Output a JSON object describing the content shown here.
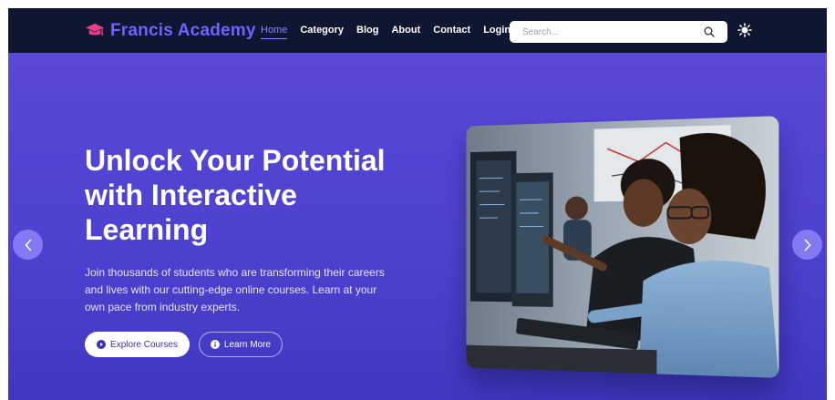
{
  "brand": {
    "name": "Francis Academy",
    "icon": "graduation-cap-icon",
    "color": "#6d63ff"
  },
  "nav": {
    "items": [
      {
        "label": "Home",
        "active": true
      },
      {
        "label": "Category",
        "active": false
      },
      {
        "label": "Blog",
        "active": false
      },
      {
        "label": "About",
        "active": false
      },
      {
        "label": "Contact",
        "active": false
      },
      {
        "label": "Login",
        "active": false
      }
    ]
  },
  "search": {
    "placeholder": "Search...",
    "value": "",
    "icon": "search-icon"
  },
  "theme_toggle": {
    "icon": "sun-icon"
  },
  "hero": {
    "title": "Unlock Your Potential with Interactive Learning",
    "description": "Join thousands of students who are transforming their careers and lives with our cutting-edge online courses. Learn at your own pace from industry experts.",
    "primary_button": {
      "label": "Explore Courses",
      "icon": "play-circle-icon"
    },
    "secondary_button": {
      "label": "Learn More",
      "icon": "info-circle-icon"
    },
    "image": {
      "subject": "students-at-computers"
    },
    "prev_icon": "chevron-left-icon",
    "next_icon": "chevron-right-icon"
  },
  "colors": {
    "navbar": "#0f1631",
    "hero_top": "#5a48d8",
    "hero_bottom": "#3f37c0",
    "accent": "#8c86ff"
  }
}
